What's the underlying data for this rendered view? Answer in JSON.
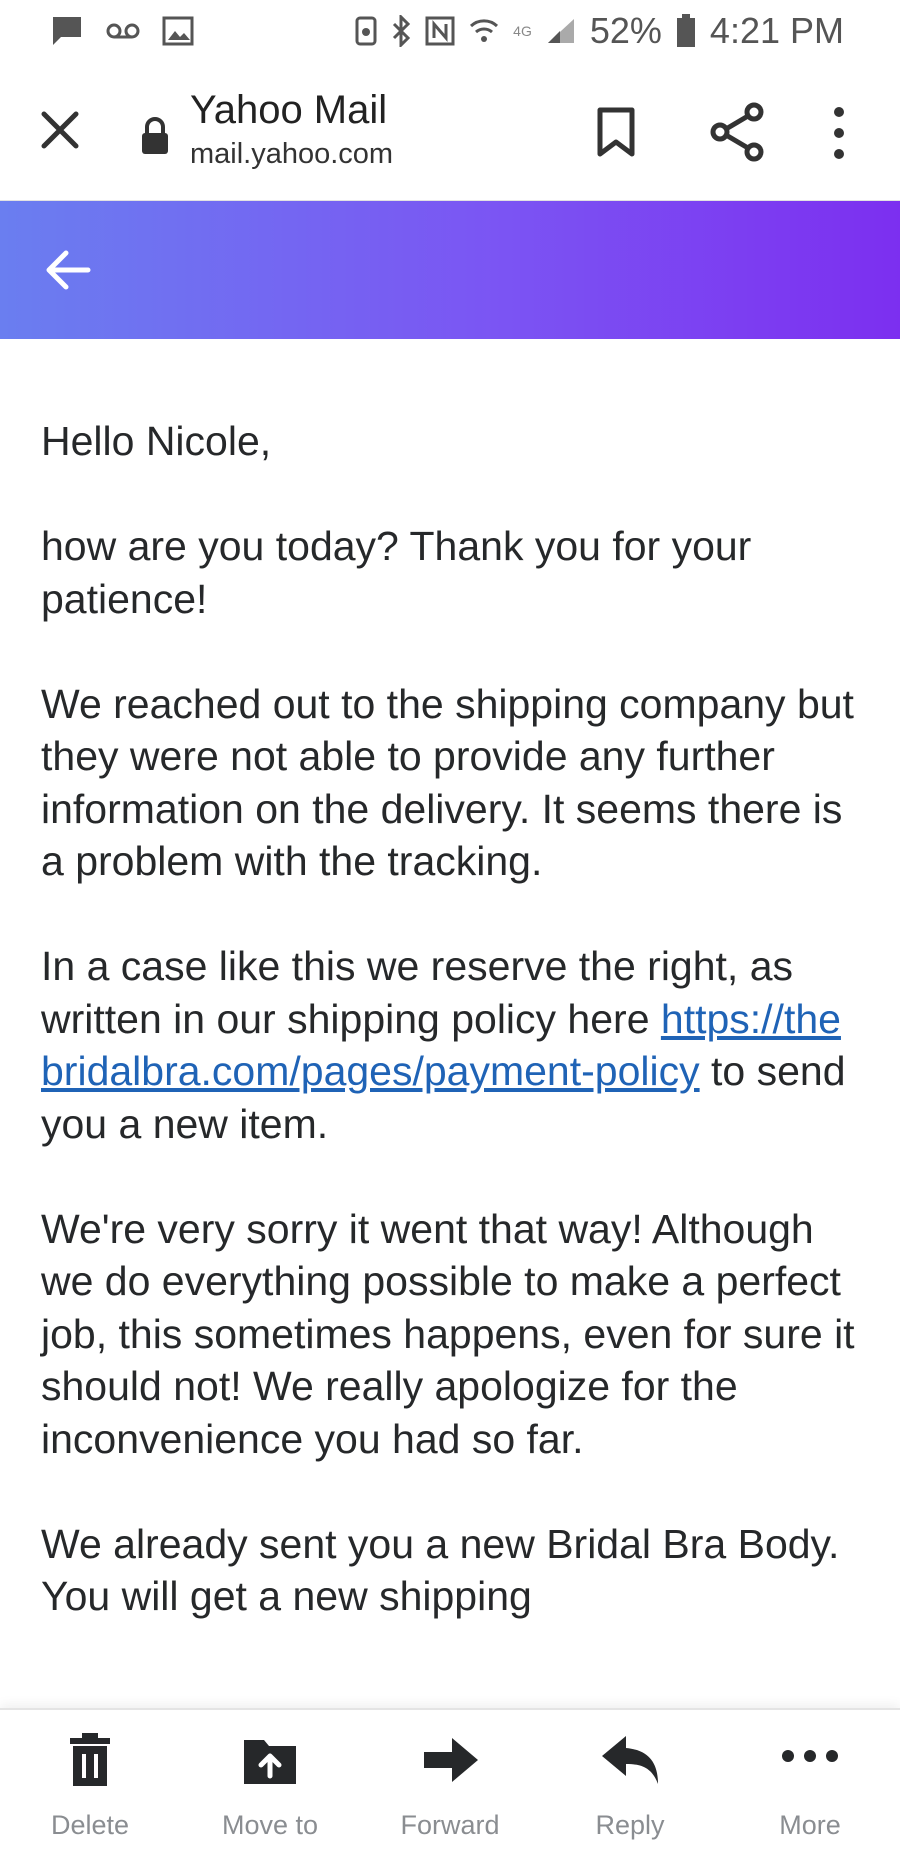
{
  "status_bar": {
    "battery": "52%",
    "time": "4:21 PM",
    "network": "4G"
  },
  "browser": {
    "site_title": "Yahoo Mail",
    "site_url": "mail.yahoo.com"
  },
  "header": {
    "gradient_start": "#6a7ef0",
    "gradient_end": "#7c2ff0"
  },
  "message": {
    "greeting": "Hello Nicole,",
    "p1": "how are you today? Thank you for your patience!",
    "p2": "We reached out to the shipping company but they were not able to provide any further information on the delivery. It seems there is a problem with the tracking.",
    "p3_before": "In a case like this we reserve the right, as written in our shipping policy here ",
    "p3_link": "https://thebridalbra.com/pages/payment-policy",
    "p3_after": " to send you a new item.",
    "p4": "We're very sorry it went that way! Although we do everything possible to make a perfect job, this sometimes happens, even for sure it should not! We really apologize for the inconvenience you had so far.",
    "p5": "We already sent you a new Bridal Bra Body. You will get a new shipping"
  },
  "toolbar": {
    "delete": "Delete",
    "move_to": "Move to",
    "forward": "Forward",
    "reply": "Reply",
    "more": "More"
  },
  "colors": {
    "link": "#1f63b6",
    "toolbar_label": "#8a8d91",
    "toolbar_icon": "#26282a"
  }
}
